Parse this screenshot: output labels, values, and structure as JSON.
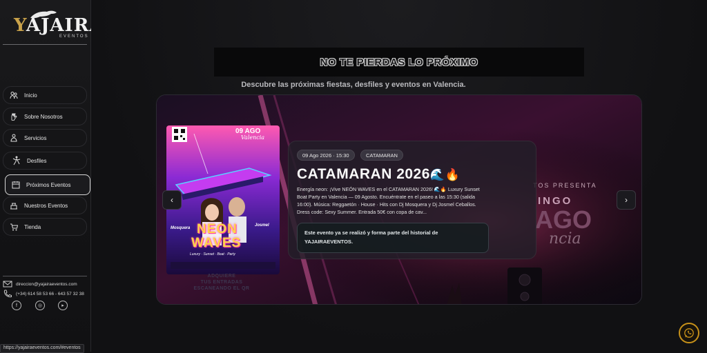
{
  "brand": {
    "name_initial": "Y",
    "name_rest": "AJAIRA",
    "subtitle": "EVENTOS"
  },
  "sidebar": {
    "items": [
      {
        "label": "Inicio",
        "icon": "user-group-icon",
        "active": false
      },
      {
        "label": "Sobre Nosotros",
        "icon": "hand-icon",
        "active": false
      },
      {
        "label": "Servicios",
        "icon": "people-icon",
        "active": false
      },
      {
        "label": "Desfiles",
        "icon": "dancer-icon",
        "active": false
      },
      {
        "label": "Próximos Eventos",
        "icon": "calendar-people-icon",
        "active": true
      },
      {
        "label": "Nuestros Eventos",
        "icon": "stage-icon",
        "active": false
      },
      {
        "label": "Tienda",
        "icon": "cart-icon",
        "active": false
      }
    ],
    "contact": {
      "email": "direccion@yajairaeventos.com",
      "phone": "(+34) 614 58 53 66 - 643 57 32 38"
    },
    "social": [
      "facebook-icon",
      "instagram-icon",
      "youtube-icon"
    ]
  },
  "status_url": "https://yajairaeventos.com/#eventos",
  "main": {
    "heading": "NO TE PIERDAS LO PRÓXIMO",
    "subheading": "Descubre las próximas fiestas, desfiles y eventos en Valencia."
  },
  "event": {
    "date_chip": "09 Ago 2026 · 15:30",
    "category_chip": "CATAMARAN",
    "title": "CATAMARAN 2026",
    "title_emoji": "🌊🔥",
    "description": "Energía neon: ¡Vive NEÓN WAVES en el CATAMARAN 2026! 🌊🔥 Luxury Sunset Boat Party en Valencia — 09 Agosto. Encuéntrate en el paseo a las 15:30 (salida 16:00). Música: Reggaetón · House · Hits con Dj Mosquera y Dj Josmel Ceballos. Dress code: Sexy Summer. Entrada 50€ con copa de cav...",
    "notice": "Este evento ya se realizó y forma parte del historial de YAJAIRAEVENTOS."
  },
  "poster": {
    "date": "09 AGO",
    "city": "Valencia",
    "headline_1": "NEON",
    "headline_2": "WAVES",
    "tagline": "Luxury · Sunset · Boat · Party",
    "dj_left": "Mosquera",
    "dj_right": "Josmel",
    "below_1": "ADQUIERE",
    "below_2": "TUS ENTRADAS",
    "below_3": "ESCANEANDO EL QR"
  },
  "backdrop": {
    "presenta": "TOS PRESENTA",
    "line1": "INGO",
    "line2": "AGO",
    "line3": "ncia"
  },
  "controls": {
    "prev": "‹",
    "next": "›"
  },
  "colors": {
    "accent_gold": "#c8921a",
    "neon_pink": "#ff3fa8",
    "neon_blue": "#3f8cff"
  }
}
